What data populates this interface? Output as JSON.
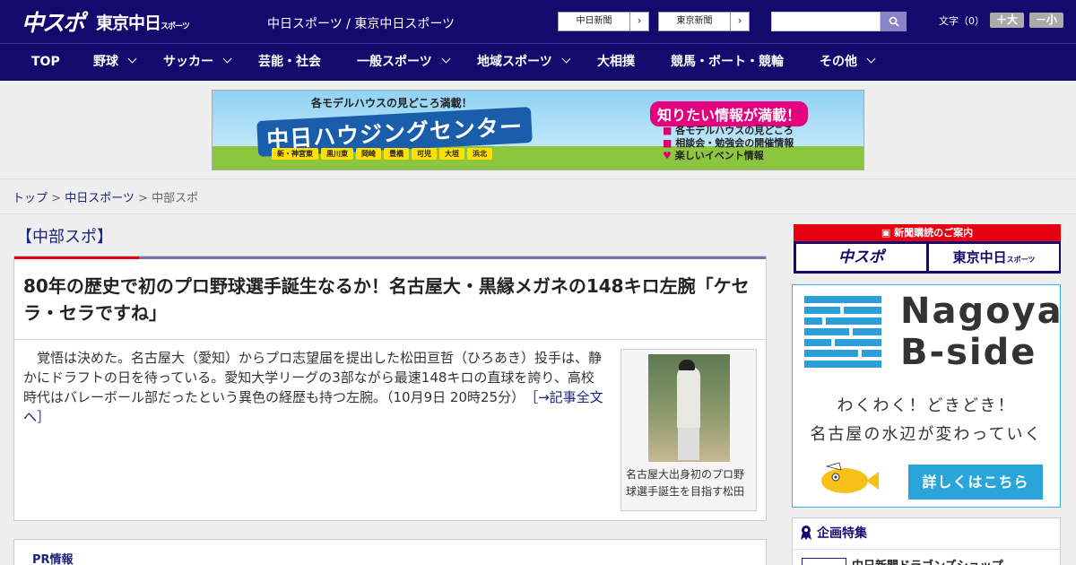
{
  "header": {
    "logo_chusupo": "中スポ",
    "logo_tokyo": "東京中日",
    "logo_tokyo_small": "スポーツ",
    "site_name": "中日スポーツ / 東京中日スポーツ",
    "newspaper_buttons": [
      {
        "label": "中日新聞"
      },
      {
        "label": "東京新聞"
      }
    ],
    "search": {
      "placeholder": "",
      "value": ""
    },
    "font_size": {
      "label": "文字（0）",
      "larger": "＋大",
      "smaller": "－小"
    }
  },
  "nav": {
    "items": [
      {
        "label": "TOP",
        "dropdown": false
      },
      {
        "label": "野球",
        "dropdown": true
      },
      {
        "label": "サッカー",
        "dropdown": true
      },
      {
        "label": "芸能・社会",
        "dropdown": false
      },
      {
        "label": "一般スポーツ",
        "dropdown": true
      },
      {
        "label": "地域スポーツ",
        "dropdown": true
      },
      {
        "label": "大相撲",
        "dropdown": false
      },
      {
        "label": "競馬・ボート・競輪",
        "dropdown": false
      },
      {
        "label": "その他",
        "dropdown": true
      }
    ]
  },
  "banner": {
    "catch": "各モデルハウスの見どころ満載！",
    "title": "中日ハウジングセンター",
    "cities": [
      "新・神宮東",
      "黒川東",
      "岡崎",
      "豊橋",
      "可児",
      "大垣",
      "浜北"
    ],
    "right_head": "知りたい情報が満載！",
    "features": [
      "各モデルハウスの見どころ",
      "相談会・勉強会の開催情報",
      "楽しいイベント情報"
    ]
  },
  "breadcrumb": {
    "top": "トップ",
    "sep": " > ",
    "mid": "中日スポーツ",
    "current": "中部スポ"
  },
  "section_title": "【中部スポ】",
  "article": {
    "headline": "80年の歴史で初のプロ野球選手誕生なるか！名古屋大・黒縁メガネの148キロ左腕「ケセラ・セラですね」",
    "summary": "覚悟は決めた。名古屋大（愛知）からプロ志望届を提出した松田亘哲（ひろあき）投手は、静かにドラフトの日を待っている。愛知大学リーグの3部ながら最速148キロの直球を誇り、高校時代はバレーボール部だったという異色の経歴も持つ左腕。（10月9日 20時25分）",
    "more_link": "［→記事全文へ］",
    "photo_caption": "名古屋大出身初のプロ野球選手誕生を目指す松田"
  },
  "pr": {
    "title": "PR情報"
  },
  "sidebar": {
    "subscription_head": "新聞購読のご案内",
    "sub_buttons": [
      "中スポ",
      "東京中日"
    ],
    "sub_button_small": "スポーツ",
    "ad": {
      "brand_line1": "Nagoya",
      "brand_line2": "B-side",
      "tagline1": "わくわく！どきどき！",
      "tagline2": "名古屋の水辺が変わっていく",
      "cta": "詳しくはこちら"
    },
    "feature": {
      "title": "企画特集",
      "item": "中日新聞ドラゴンズショップ"
    }
  },
  "colors": {
    "header_bg": "#140a6e",
    "accent_red": "#e60012",
    "link": "#1a237e",
    "ad_blue": "#2aa5dc"
  }
}
